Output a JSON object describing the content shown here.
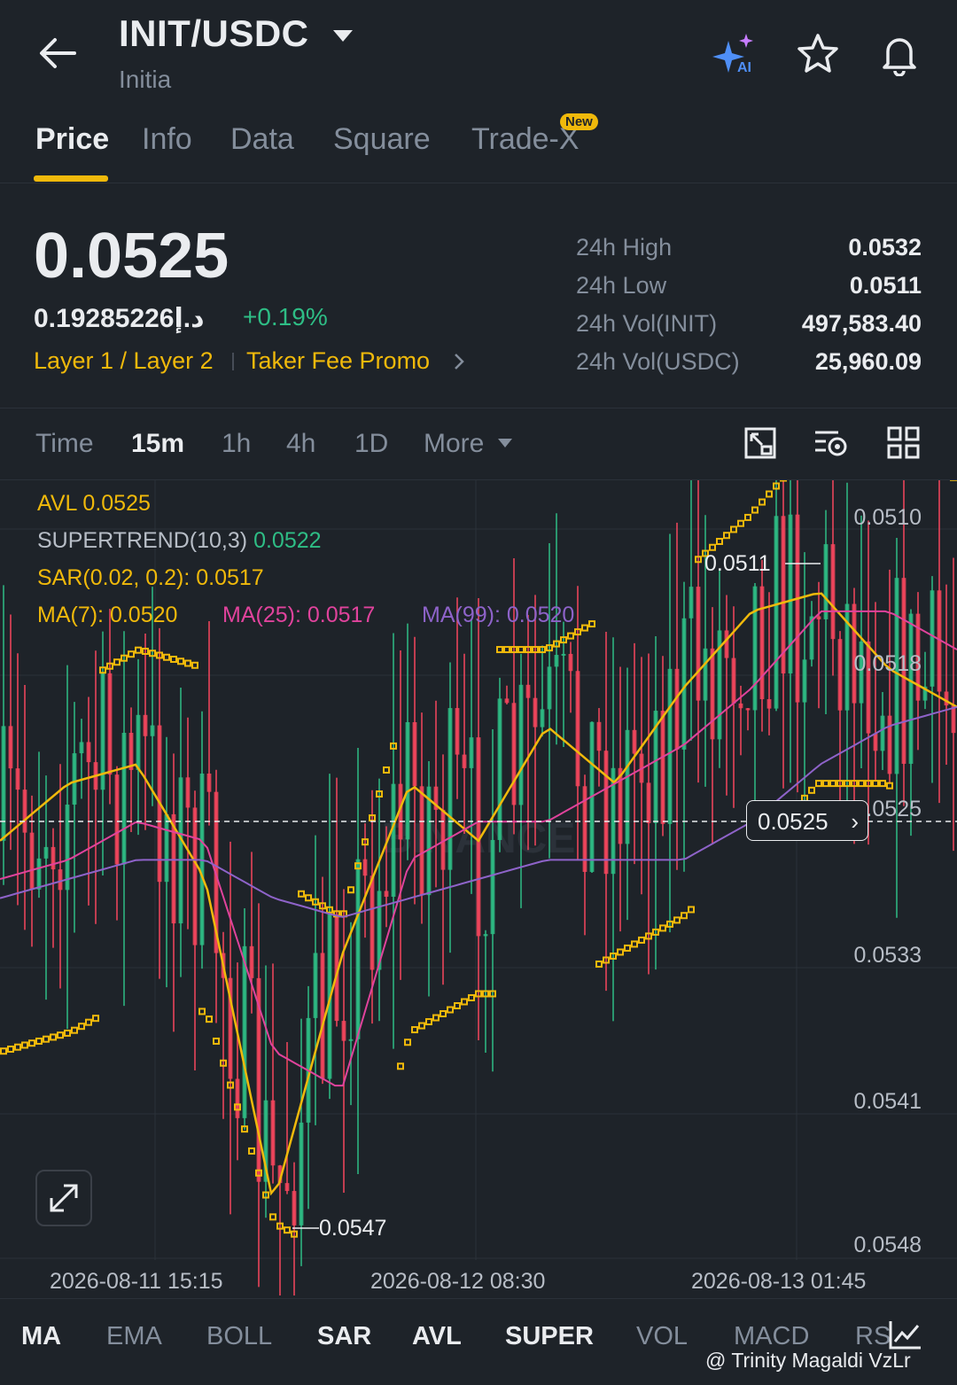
{
  "header": {
    "pair": "INIT/USDC",
    "subtitle": "Initia",
    "ai_label": "AI"
  },
  "tabs": [
    {
      "label": "Price",
      "active": true
    },
    {
      "label": "Info"
    },
    {
      "label": "Data"
    },
    {
      "label": "Square"
    },
    {
      "label": "Trade-X",
      "badge": "New"
    }
  ],
  "price": {
    "last": "0.0525",
    "local": "0.19285226د.إ",
    "change": "+0.19%",
    "tags": [
      "Layer 1 / Layer 2",
      "Taker Fee Promo"
    ]
  },
  "stats": [
    {
      "label": "24h High",
      "value": "0.0532"
    },
    {
      "label": "24h Low",
      "value": "0.0511"
    },
    {
      "label": "24h Vol(INIT)",
      "value": "497,583.40"
    },
    {
      "label": "24h Vol(USDC)",
      "value": "25,960.09"
    }
  ],
  "intervals": [
    "Time",
    "15m",
    "1h",
    "4h",
    "1D",
    "More"
  ],
  "active_interval": "15m",
  "legend": {
    "avl": "AVL 0.0525",
    "supertrend_label": "SUPERTREND(10,3)",
    "supertrend_value": "0.0522",
    "sar": "SAR(0.02, 0.2): 0.0517",
    "ma7": "MA(7): 0.0520",
    "ma25": "MA(25): 0.0517",
    "ma99": "MA(99): 0.0520"
  },
  "y_axis": [
    "0.0510",
    "0.0518",
    "0.0525",
    "0.0533",
    "0.0541",
    "0.0548"
  ],
  "x_axis": [
    "2026-08-11 15:15",
    "2026-08-12 08:30",
    "2026-08-13 01:45"
  ],
  "markers": {
    "high": "0.0511",
    "low": "0.0547",
    "last_price_tag": "0.0525"
  },
  "watermark_chart": "BINANCE",
  "indicators": [
    {
      "label": "MA",
      "on": true
    },
    {
      "label": "EMA",
      "on": false
    },
    {
      "label": "BOLL",
      "on": false
    },
    {
      "label": "SAR",
      "on": true
    },
    {
      "label": "AVL",
      "on": true
    },
    {
      "label": "SUPER",
      "on": true
    },
    {
      "label": "VOL",
      "on": false
    },
    {
      "label": "MACD",
      "on": false
    },
    {
      "label": "RS",
      "on": false
    }
  ],
  "watermark_user": "@ Trinity Magaldi VzLr",
  "colors": {
    "background": "#1e2329",
    "accent": "#f0b90b",
    "up": "#2ebd85",
    "down": "#f6465d",
    "ma7": "#f0b90b",
    "ma25": "#e0439c",
    "ma99": "#8e63c9"
  },
  "chart_data": {
    "type": "line",
    "title": "",
    "xlabel": "",
    "ylabel": "",
    "ylim_inverted": [
      0.0548,
      0.051
    ],
    "x": [
      "2026-08-11 15:15",
      "2026-08-12 08:30",
      "2026-08-13 01:45"
    ],
    "series": [
      {
        "name": "MA(7)",
        "values": [
          0.0527,
          0.0524,
          0.0523,
          0.0529,
          0.0546,
          0.0533,
          0.0524,
          0.0527,
          0.0521,
          0.0524,
          0.0519,
          0.0515,
          0.0514,
          0.0518,
          0.052
        ]
      },
      {
        "name": "MA(25)",
        "values": [
          0.0529,
          0.0528,
          0.0526,
          0.0527,
          0.0538,
          0.054,
          0.0528,
          0.0526,
          0.0526,
          0.0524,
          0.0522,
          0.0519,
          0.0515,
          0.0515,
          0.0517
        ]
      },
      {
        "name": "MA(99)",
        "values": [
          0.053,
          0.0529,
          0.0528,
          0.0528,
          0.053,
          0.0531,
          0.053,
          0.0529,
          0.0528,
          0.0528,
          0.0528,
          0.0526,
          0.0523,
          0.0521,
          0.052
        ]
      }
    ]
  }
}
